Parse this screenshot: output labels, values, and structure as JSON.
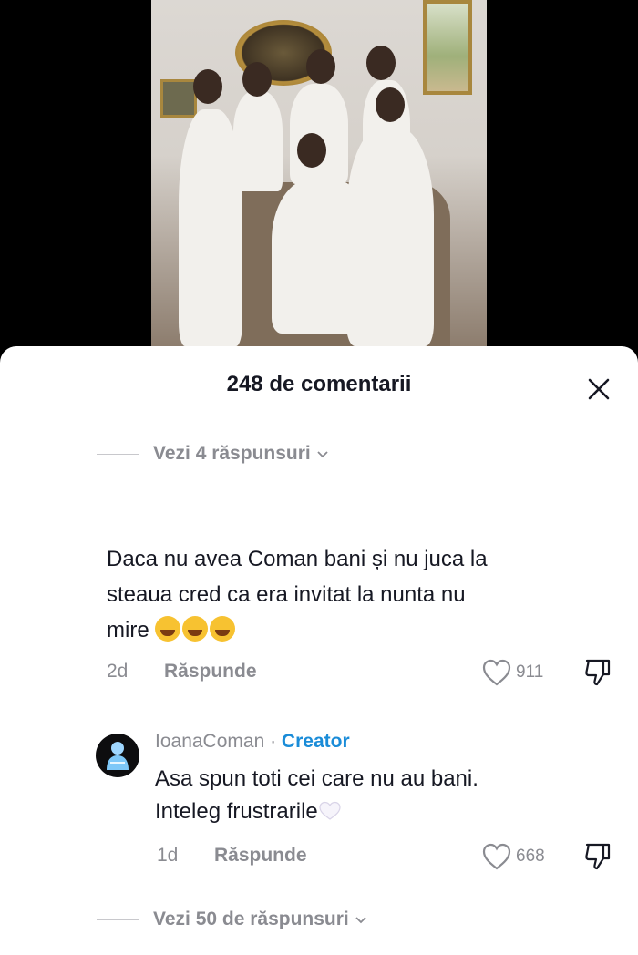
{
  "sheet": {
    "title": "248 de comentarii"
  },
  "top_replies": {
    "label": "Vezi 4 răspunsuri"
  },
  "comment": {
    "text_line1": "Daca nu avea Coman bani și nu juca la",
    "text_line2": "steaua cred ca era invitat la nunta nu",
    "text_line3": "mire",
    "emoji": "rolling-on-floor-laughing",
    "age": "2d",
    "reply_label": "Răspunde",
    "likes": "911"
  },
  "reply": {
    "username": "IoanaComan",
    "separator": " · ",
    "badge": "Creator",
    "text_line1": "Asa spun toti cei care nu au bani.",
    "text_line2": "Inteleg frustrarile",
    "emoji": "white-heart",
    "age": "1d",
    "reply_label": "Răspunde",
    "likes": "668"
  },
  "bottom_replies": {
    "label": "Vezi 50 de răspunsuri"
  },
  "colors": {
    "text_primary": "#161823",
    "text_secondary": "#8a8b91",
    "creator_badge": "#1a8cd8",
    "sheet_bg": "#ffffff"
  }
}
